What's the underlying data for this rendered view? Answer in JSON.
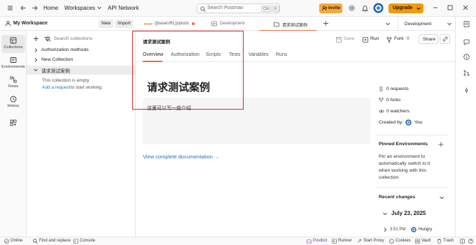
{
  "topbar": {
    "home": "Home",
    "workspaces": "Workspaces",
    "api_network": "API Network",
    "search_placeholder": "Search Postman",
    "shortcut_ctrl": "Ctrl",
    "shortcut_k": "K",
    "invite": "Invite",
    "upgrade": "Upgrade"
  },
  "workspace": {
    "name": "My Workspace",
    "new_label": "New",
    "import_label": "Import"
  },
  "tabs": [
    {
      "method": "POST",
      "label": "{{baseURL}}/posts"
    },
    {
      "label": "Development"
    },
    {
      "label": "请求测试案例"
    }
  ],
  "environment": {
    "selected": "Development"
  },
  "rail": {
    "items": [
      {
        "label": "Collections"
      },
      {
        "label": "Environments"
      },
      {
        "label": "Flows"
      },
      {
        "label": "History"
      }
    ]
  },
  "sidebar": {
    "search_placeholder": "Search collections",
    "items": [
      {
        "label": "Authorization methods"
      },
      {
        "label": "New Collection"
      },
      {
        "label": "请求测试案例"
      }
    ],
    "empty_text": "This collection is empty.",
    "add_link": "Add a request",
    "add_suffix": " to start working."
  },
  "main": {
    "breadcrumb": "请求测试案例",
    "actions": {
      "save": "Save",
      "run": "Run",
      "fork": "Fork",
      "fork_count": "0",
      "share": "Share"
    },
    "tabs": [
      "Overview",
      "Authorization",
      "Scripts",
      "Tests",
      "Variables",
      "Runs"
    ],
    "title": "请求测试案例",
    "description": "这里可以写一些介绍",
    "doc_link": "View complete documentation →"
  },
  "right_panel": {
    "requests": "0 requests",
    "forks": "0 forks",
    "watchers": "0 watchers",
    "created_by_label": "Created by:",
    "created_by_user": "You",
    "pinned_title": "Pinned Environments",
    "pinned_text_lines": [
      "Pin an environment to",
      "automatically switch to it",
      "when working with this",
      "collection"
    ],
    "recent_title": "Recent changes",
    "recent_date": "July 23, 2025",
    "recent_time": "3:51 PM",
    "recent_user": "Hungry"
  },
  "statusbar": {
    "online": "Online",
    "find_replace": "Find and replace",
    "console": "Console",
    "postbot": "Postbot",
    "runner": "Runner",
    "start_proxy": "Start Proxy",
    "cookies": "Cookies",
    "vault": "Vault",
    "trash": "Trash"
  },
  "colors": {
    "accent_orange": "#ef9a0f",
    "active_tab_underline": "#f26b3a",
    "annotation_red": "#e3202a",
    "link_blue": "#1f6fd1",
    "postbot_purple": "#7b2bd6"
  }
}
